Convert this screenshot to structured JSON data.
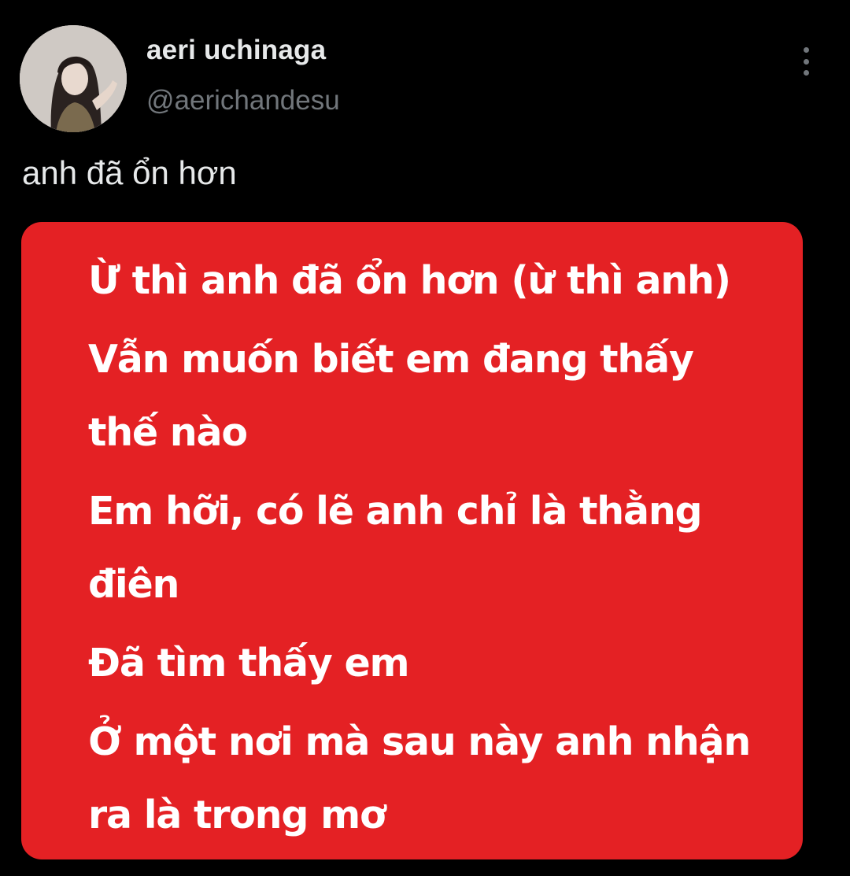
{
  "tweet": {
    "author": {
      "display_name": "aeri uchinaga",
      "handle": "@aerichandesu",
      "avatar_icon": "profile-photo"
    },
    "more_icon": "vertical-ellipsis-icon",
    "text": "anh đã ổn hơn",
    "card": {
      "background": "#e42124",
      "text_color": "#ffffff",
      "lines": [
        [
          "Ừ thì anh đã ổn hơn (ừ thì anh)"
        ],
        [
          "Vẫn muốn biết em đang thấy",
          "thế nào"
        ],
        [
          "Em hỡi, có lẽ anh chỉ là thằng",
          "điên"
        ],
        [
          "Đã tìm thấy em"
        ],
        [
          "Ở một nơi mà sau này anh nhận",
          "ra là trong mơ"
        ]
      ]
    }
  },
  "colors": {
    "background": "#000000",
    "primary_text": "#e7e9ea",
    "secondary_text": "#71767b"
  }
}
